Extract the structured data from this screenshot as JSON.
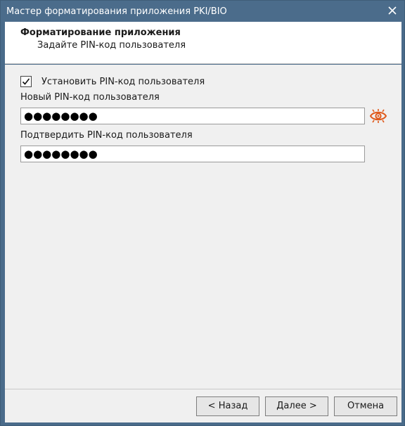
{
  "window": {
    "title": "Мастер форматирования приложения PKI/BIO"
  },
  "header": {
    "title": "Форматирование приложения",
    "subtitle": "Задайте PIN-код пользователя"
  },
  "form": {
    "set_pin_checkbox": {
      "label": "Установить PIN-код пользователя",
      "checked": true
    },
    "new_pin": {
      "label": "Новый PIN-код пользователя",
      "value": "●●●●●●●●"
    },
    "confirm_pin": {
      "label": "Подтвердить PIN-код пользователя",
      "value": "●●●●●●●●"
    },
    "show_password_icon": "eye-icon"
  },
  "footer": {
    "back_label": "< Назад",
    "next_label": "Далее >",
    "cancel_label": "Отмена"
  },
  "colors": {
    "titlebar": "#4b6c8b",
    "eye_icon": "#e05a1c"
  }
}
